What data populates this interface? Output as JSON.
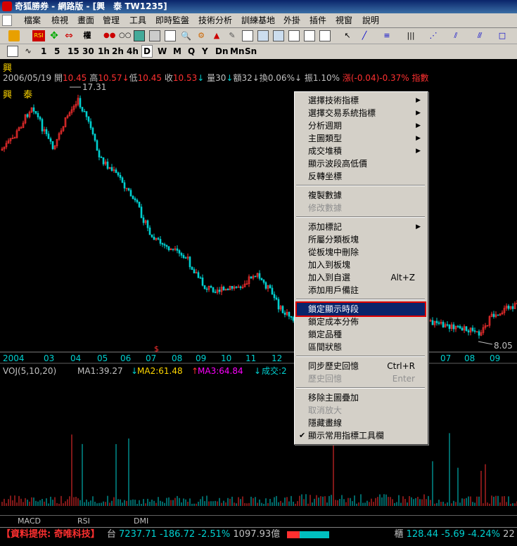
{
  "window": {
    "title": "奇狐勝券 - 網路版 - [興　泰 TW1235]"
  },
  "menu": [
    "檔案",
    "檢視",
    "畫面",
    "管理",
    "工具",
    "即時監盤",
    "技術分析",
    "訓練基地",
    "外掛",
    "插件",
    "視窗",
    "說明"
  ],
  "toolbar": {
    "weight_label": "權"
  },
  "periods": [
    "1",
    "5",
    "15",
    "30",
    "1h",
    "2h",
    "4h",
    "D",
    "W",
    "M",
    "Q",
    "Y",
    "Dn",
    "Mn",
    "Sn"
  ],
  "period_active": "D",
  "stock": {
    "name": "興",
    "date": "2006/05/19",
    "open_label": "開",
    "open": "10.45",
    "high_label": "高",
    "high": "10.57",
    "low_label": "低",
    "low": "10.45",
    "close_label": "收",
    "close": "10.53",
    "vol_label": "量",
    "vol": "30",
    "amt_label": "額",
    "amt": "32",
    "turn_label": "換",
    "turn": "0.06%",
    "amp_label": "振",
    "amp": "1.10%",
    "chg_label": "漲",
    "chg": "(-0.04)-0.37%",
    "idx_label": "指數"
  },
  "chart_label": "興 泰",
  "chart": {
    "peak_label": "17.31",
    "trough_label": "8.05",
    "x_labels": [
      "2004",
      "03",
      "04",
      "05",
      "06",
      "07",
      "08",
      "09",
      "10",
      "11",
      "12",
      "07",
      "08",
      "09"
    ],
    "marker_s": "$"
  },
  "indicator": {
    "name": "VOJ(5,10,20)",
    "ma1": "MA1:39.27",
    "ma2": "MA2:61.48",
    "ma3": "MA3:64.84",
    "vol_label": "成交:2"
  },
  "bottom_tabs": [
    "MACD",
    "RSI",
    "DMI"
  ],
  "status": {
    "provider": "【資料提供: 奇唯科技】",
    "tw_label": "台",
    "tw_index": "7237.71",
    "tw_change": "-186.72",
    "tw_pct": "-2.51%",
    "tw_amount": "1097.93億",
    "g_label": "櫃",
    "g_index": "128.44",
    "g_change": "-5.69",
    "g_pct": "-4.24%",
    "g_more": "22"
  },
  "context_menu": {
    "items": [
      {
        "label": "選擇技術指標",
        "submenu": true
      },
      {
        "label": "選擇交易系統指標",
        "submenu": true
      },
      {
        "label": "分析週期",
        "submenu": true
      },
      {
        "label": "主圖類型",
        "submenu": true
      },
      {
        "label": "成交堆積",
        "submenu": true
      },
      {
        "label": "顯示波段高低價"
      },
      {
        "label": "反轉坐標"
      },
      {
        "label": "複製數據"
      },
      {
        "label": "修改數據",
        "disabled": true
      },
      {
        "label": "添加標記",
        "submenu": true
      },
      {
        "label": "所屬分類板塊"
      },
      {
        "label": "從板塊中刪除"
      },
      {
        "label": "加入到板塊"
      },
      {
        "label": "加入到自選",
        "shortcut": "Alt+Z"
      },
      {
        "label": "添加用戶備註"
      },
      {
        "label": "鎖定顯示時段",
        "highlighted": true
      },
      {
        "label": "鎖定成本分佈"
      },
      {
        "label": "鎖定品種"
      },
      {
        "label": "區間狀態"
      },
      {
        "label": "同步歷史回憶",
        "shortcut": "Ctrl+R"
      },
      {
        "label": "歷史回憶",
        "disabled": true,
        "shortcut": "Enter"
      },
      {
        "label": "移除主圖疊加"
      },
      {
        "label": "取消放大",
        "disabled": true
      },
      {
        "label": "隱藏畫線"
      },
      {
        "label": "顯示常用指標工具欄",
        "checked": true
      }
    ]
  }
}
